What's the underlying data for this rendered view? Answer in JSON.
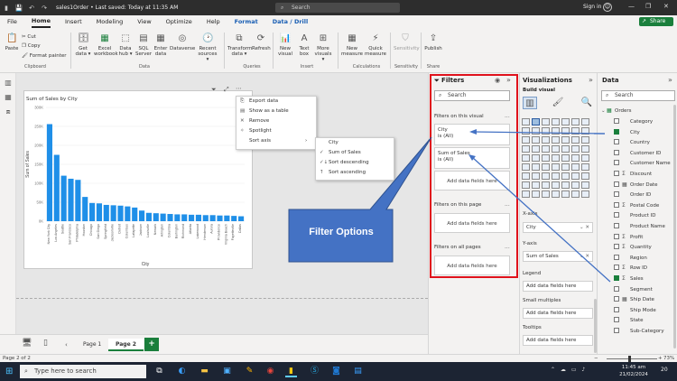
{
  "titlebar": {
    "doc_title": "sales1Order • Last saved: Today at 11:35 AM",
    "search_placeholder": "Search",
    "signin": "Sign in",
    "minimize": "—",
    "maximize": "❐",
    "close": "✕"
  },
  "menu": {
    "tabs": [
      "File",
      "Home",
      "Insert",
      "Modeling",
      "View",
      "Optimize",
      "Help",
      "Format",
      "Data / Drill"
    ],
    "share": "Share"
  },
  "ribbon": {
    "paste": "Paste",
    "cut": "Cut",
    "copy": "Copy",
    "format_painter": "Format painter",
    "get_data": "Get data ▾",
    "excel_workbook": "Excel workbook",
    "data_hub": "Data hub ▾",
    "sql_server": "SQL Server",
    "enter_data": "Enter data",
    "dataverse": "Dataverse",
    "recent_sources": "Recent sources ▾",
    "transform_data": "Transform data ▾",
    "refresh": "Refresh",
    "new_visual": "New visual",
    "text_box": "Text box",
    "more_visuals": "More visuals ▾",
    "new_measure": "New measure",
    "quick_measure": "Quick measure",
    "sensitivity": "Sensitivity",
    "publish": "Publish",
    "groups": {
      "clipboard": "Clipboard",
      "data": "Data",
      "queries": "Queries",
      "insert": "Insert",
      "calculations": "Calculations",
      "sensitivity": "Sensitivity",
      "share": "Share"
    }
  },
  "context_menu": {
    "items": [
      "Export data",
      "Show as a table",
      "Remove",
      "Spotlight",
      "Sort axis"
    ],
    "sort_arrow": "›"
  },
  "submenu": {
    "items": [
      "City",
      "Sum of Sales",
      "Sort descending",
      "Sort ascending"
    ]
  },
  "callout": {
    "text": "Filter Options"
  },
  "filters": {
    "title": "Filters",
    "search_placeholder": "Search",
    "on_visual": "Filters on this visual",
    "cards": [
      {
        "name": "City",
        "value": "is (All)"
      },
      {
        "name": "Sum of Sales",
        "value": "is (All)"
      }
    ],
    "add_fields": "Add data fields here",
    "on_page": "Filters on this page",
    "on_all_pages": "Filters on all pages",
    "dots": "..."
  },
  "visualizations": {
    "title": "Visualizations",
    "build_visual": "Build visual",
    "x_axis": "X-axis",
    "x_axis_field": "City",
    "y_axis": "Y-axis",
    "y_axis_field": "Sum of Sales",
    "legend": "Legend",
    "small_multiples": "Small multiples",
    "tooltips": "Tooltips",
    "add_fields": "Add data fields here"
  },
  "data_pane": {
    "title": "Data",
    "search_placeholder": "Search",
    "table": "Orders",
    "fields": [
      {
        "name": "Category",
        "checked": false,
        "sigma": false
      },
      {
        "name": "City",
        "checked": true,
        "sigma": false
      },
      {
        "name": "Country",
        "checked": false,
        "sigma": false
      },
      {
        "name": "Customer ID",
        "checked": false,
        "sigma": false
      },
      {
        "name": "Customer Name",
        "checked": false,
        "sigma": false
      },
      {
        "name": "Discount",
        "checked": false,
        "sigma": true
      },
      {
        "name": "Order Date",
        "checked": false,
        "sigma": false,
        "hier": true
      },
      {
        "name": "Order ID",
        "checked": false,
        "sigma": false
      },
      {
        "name": "Postal Code",
        "checked": false,
        "sigma": true
      },
      {
        "name": "Product ID",
        "checked": false,
        "sigma": false
      },
      {
        "name": "Product Name",
        "checked": false,
        "sigma": false
      },
      {
        "name": "Profit",
        "checked": false,
        "sigma": true
      },
      {
        "name": "Quantity",
        "checked": false,
        "sigma": true
      },
      {
        "name": "Region",
        "checked": false,
        "sigma": false
      },
      {
        "name": "Row ID",
        "checked": false,
        "sigma": true
      },
      {
        "name": "Sales",
        "checked": true,
        "sigma": true
      },
      {
        "name": "Segment",
        "checked": false,
        "sigma": false
      },
      {
        "name": "Ship Date",
        "checked": false,
        "sigma": false,
        "hier": true
      },
      {
        "name": "Ship Mode",
        "checked": false,
        "sigma": false
      },
      {
        "name": "State",
        "checked": false,
        "sigma": false
      },
      {
        "name": "Sub-Category",
        "checked": false,
        "sigma": false
      }
    ]
  },
  "pages": {
    "tabs": [
      "Page 1",
      "Page 2"
    ],
    "active": 1,
    "add": "+"
  },
  "status": {
    "page_count": "Page 2 of 2",
    "zoom_minus": "−",
    "zoom_plus": "+",
    "zoom": "73%"
  },
  "taskbar": {
    "search_placeholder": "Type here to search",
    "time": "11:45 am",
    "date": "21/02/2024",
    "notif": "20"
  },
  "colors": {
    "bar": "#1f8fe8",
    "brand_green": "#1a7f3c",
    "highlight_red": "#e0121c",
    "callout_blue": "#4472c4"
  },
  "chart_data": {
    "type": "bar",
    "title": "Sum of Sales by City",
    "xlabel": "City",
    "ylabel": "Sum of Sales",
    "ylim": [
      0,
      300000
    ],
    "yticks": [
      "0K",
      "50K",
      "100K",
      "150K",
      "200K",
      "250K",
      "300K"
    ],
    "categories": [
      "New York City",
      "Los Angeles",
      "Seattle",
      "San Francisco",
      "Philadelphia",
      "Houston",
      "Chicago",
      "San Diego",
      "Springfield",
      "Jacksonville",
      "Detroit",
      "Columbus",
      "Lafayette",
      "Jackson",
      "Louisville",
      "Newark",
      "Arlington",
      "Columbia",
      "Burlington",
      "Richmond",
      "Atlanta",
      "Lakewood",
      "Henderson",
      "Aurora",
      "Providence",
      "Virginia Beach",
      "Fayetteville",
      "Dallas"
    ],
    "values": [
      256000,
      175000,
      120000,
      112000,
      109000,
      64000,
      48000,
      47000,
      43000,
      42000,
      41000,
      39000,
      36000,
      28000,
      22000,
      21000,
      20000,
      19000,
      18000,
      18000,
      17000,
      17000,
      16000,
      16000,
      15000,
      15000,
      14000,
      13000
    ]
  }
}
